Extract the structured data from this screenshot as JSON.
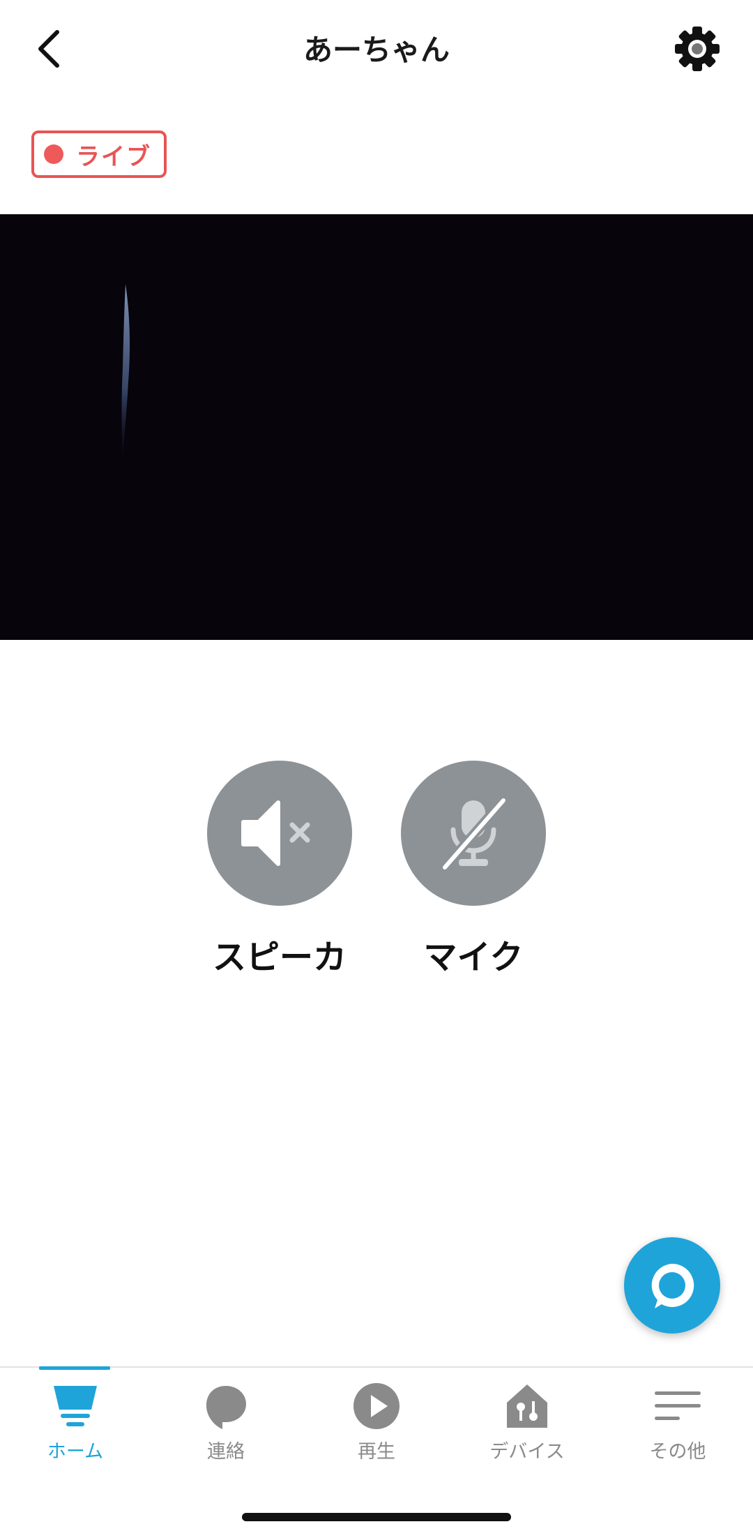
{
  "header": {
    "title": "あーちゃん",
    "back_icon": "chevron-left-icon",
    "settings_icon": "gear-icon"
  },
  "live_badge": {
    "label": "ライブ",
    "color": "#e85454"
  },
  "controls": [
    {
      "label": "スピーカ",
      "icon": "speaker-muted-icon",
      "state": "muted"
    },
    {
      "label": "マイク",
      "icon": "mic-muted-icon",
      "state": "muted"
    }
  ],
  "alexa_button": {
    "icon": "alexa-ring-icon",
    "color": "#1ea4d8"
  },
  "bottom_nav": {
    "active": "ホーム",
    "items": [
      {
        "label": "ホーム",
        "icon": "home-icon"
      },
      {
        "label": "連絡",
        "icon": "chat-bubble-icon"
      },
      {
        "label": "再生",
        "icon": "play-icon"
      },
      {
        "label": "デバイス",
        "icon": "devices-house-icon"
      },
      {
        "label": "その他",
        "icon": "menu-lines-icon"
      }
    ]
  },
  "colors": {
    "accent": "#1ea4d8",
    "control_bg": "#8d9296",
    "video_bg": "#07040b"
  }
}
